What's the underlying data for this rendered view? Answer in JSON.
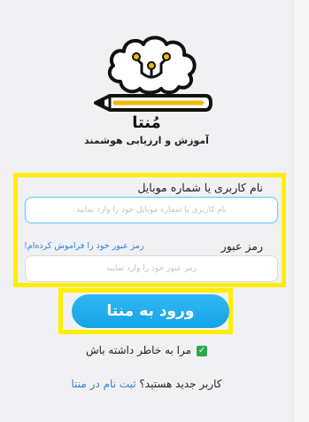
{
  "brand": {
    "name": "مُنتا",
    "tagline": "آموزش و ارزیابی هوشمند"
  },
  "form": {
    "username_label": "نام کاربری یا شماره موبایل",
    "username_placeholder": "نام کاربری یا شماره موبایل خود را وارد نمایید",
    "password_label": "رمز عبور",
    "password_placeholder": "رمز عبور خود را وارد نمایید",
    "forgot_link": "رمز عبور خود را فراموش کرده‌ام!",
    "login_button": "ورود به منتا",
    "remember_me": "مرا به خاطر داشته باش",
    "remember_checked": true,
    "signup_question": "کاربر جدید هستید؟",
    "signup_link": "ثبت نام در منتا"
  },
  "colors": {
    "accent": "#12a4ea",
    "highlight": "#ffee00",
    "link": "#2f7fd6",
    "logo_gold": "#f2b705"
  }
}
